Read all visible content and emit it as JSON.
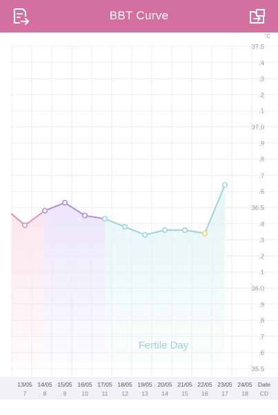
{
  "header": {
    "title": "BBT Curve",
    "left_icon": "export-report-icon",
    "right_icon": "switch-view-icon",
    "background": "#d4709f"
  },
  "chart_data": {
    "type": "line",
    "unit_label": "°C",
    "ylim": [
      35.45,
      37.5
    ],
    "y_ticks": [
      {
        "value": 37.5,
        "label": "37.5"
      },
      {
        "value": 37.4,
        "label": ".4"
      },
      {
        "value": 37.3,
        "label": ".3"
      },
      {
        "value": 37.2,
        "label": ".2"
      },
      {
        "value": 37.1,
        "label": ".1"
      },
      {
        "value": 37.0,
        "label": "37.0"
      },
      {
        "value": 36.9,
        "label": ".9"
      },
      {
        "value": 36.8,
        "label": ".8"
      },
      {
        "value": 36.7,
        "label": ".7"
      },
      {
        "value": 36.6,
        "label": ".6"
      },
      {
        "value": 36.5,
        "label": "36.5"
      },
      {
        "value": 36.4,
        "label": ".4"
      },
      {
        "value": 36.3,
        "label": ".3"
      },
      {
        "value": 36.2,
        "label": ".2"
      },
      {
        "value": 36.1,
        "label": ".1"
      },
      {
        "value": 36.0,
        "label": "36.0"
      },
      {
        "value": 35.9,
        "label": ".9"
      },
      {
        "value": 35.8,
        "label": ".8"
      },
      {
        "value": 35.7,
        "label": ".7"
      },
      {
        "value": 35.6,
        "label": ".6"
      },
      {
        "value": 35.5,
        "label": "35.5"
      }
    ],
    "dates": [
      "13/05",
      "14/05",
      "15/05",
      "16/05",
      "17/05",
      "18/05",
      "19/05",
      "20/05",
      "21/05",
      "22/05",
      "23/05",
      "24/05"
    ],
    "cycle_days": [
      "7",
      "8",
      "9",
      "10",
      "11",
      "12",
      "13",
      "14",
      "15",
      "16",
      "17",
      "18"
    ],
    "x_axis_name": "Date",
    "cd_axis_name": "CD",
    "lead_in_value": 36.46,
    "points": [
      {
        "date": "13/05",
        "value": 36.39,
        "phase": "period"
      },
      {
        "date": "14/05",
        "value": 36.48,
        "phase": "follicular"
      },
      {
        "date": "15/05",
        "value": 36.53,
        "phase": "follicular"
      },
      {
        "date": "16/05",
        "value": 36.45,
        "phase": "follicular"
      },
      {
        "date": "17/05",
        "value": 36.43,
        "phase": "fertile"
      },
      {
        "date": "18/05",
        "value": 36.38,
        "phase": "fertile"
      },
      {
        "date": "19/05",
        "value": 36.33,
        "phase": "fertile"
      },
      {
        "date": "20/05",
        "value": 36.36,
        "phase": "fertile"
      },
      {
        "date": "21/05",
        "value": 36.36,
        "phase": "fertile"
      },
      {
        "date": "22/05",
        "value": 36.34,
        "phase": "ovulation"
      },
      {
        "date": "23/05",
        "value": 36.64,
        "phase": "fertile"
      }
    ],
    "phase_label": "Fertile Day",
    "colors": {
      "period": "#e48fb5",
      "follicular": "#ad8ee0",
      "fertile": "#9dd2df",
      "ovulation": "#f2d36b",
      "period_fill": "#fbe4ee",
      "follicular_fill": "#ebe4fb",
      "fertile_fill": "#e3f4f6",
      "grid": "#ebebeb",
      "tick_text": "#9a9a9a"
    }
  }
}
